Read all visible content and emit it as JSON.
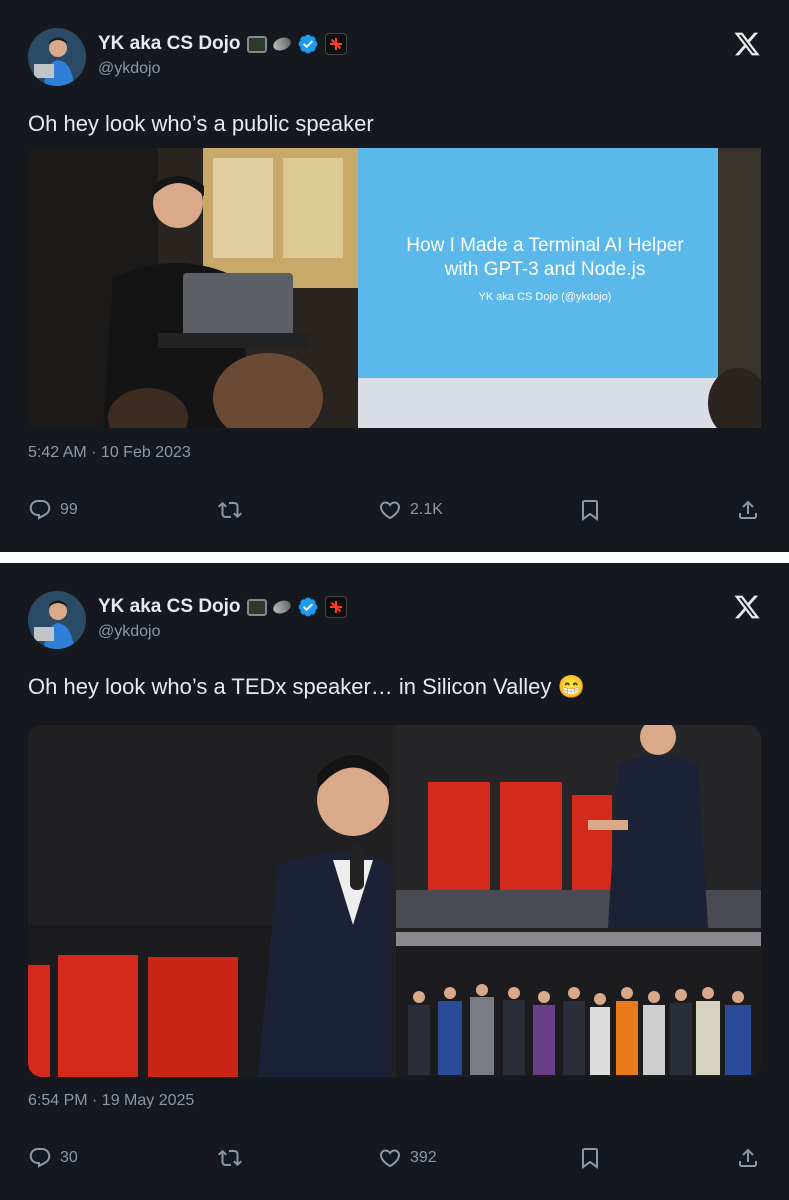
{
  "tweets": [
    {
      "author": {
        "name": "YK aka CS Dojo",
        "handle": "@ykdojo"
      },
      "text": "Oh hey look who’s a public speaker",
      "slide": {
        "line1": "How I Made a Terminal AI Helper",
        "line2": "with GPT-3 and Node.js",
        "line3": "YK aka CS Dojo (@ykdojo)"
      },
      "timestamp": "5:42 AM · 10 Feb 2023",
      "stats": {
        "replies": "99",
        "likes": "2.1K"
      }
    },
    {
      "author": {
        "name": "YK aka CS Dojo",
        "handle": "@ykdojo"
      },
      "text": "Oh hey look who’s a TEDx speaker… in Silicon Valley 😁",
      "timestamp": "6:54 PM · 19 May 2025",
      "stats": {
        "replies": "30",
        "likes": "392"
      }
    }
  ],
  "colors": {
    "background": "#16181f",
    "muted": "#8b98a5",
    "verified": "#1d9bf0",
    "ted_red": "#e62b1e"
  },
  "icons": [
    "reply-icon",
    "retweet-icon",
    "like-icon",
    "bookmark-icon",
    "share-icon",
    "x-logo-icon",
    "verified-badge-icon"
  ]
}
